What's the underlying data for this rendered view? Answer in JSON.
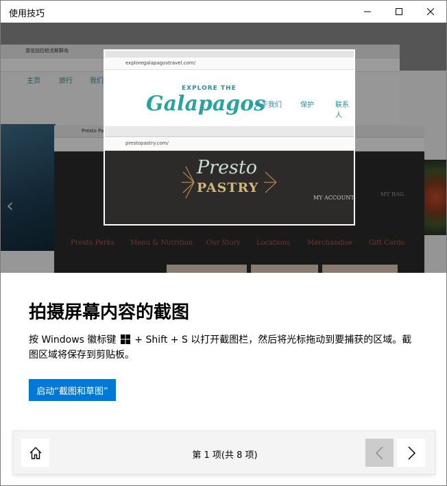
{
  "window": {
    "title": "使用技巧",
    "controls": [
      "minimize-icon",
      "maximize-icon",
      "close-icon"
    ]
  },
  "hero": {
    "bg_site": {
      "tab_title": "游览加拉帕戈斯群岛",
      "nav": [
        "主页",
        "旅行",
        "我们的 方法"
      ]
    },
    "snip_site": {
      "url": "exploregalapagostravel.com/",
      "logo_small": "EXPLORE THE",
      "logo_big": "Galapagos",
      "nav": [
        "关于我们",
        "保护",
        "联系人"
      ]
    },
    "pp_site": {
      "tab_title": "Presto Pastry",
      "url": "prestopastry.com/",
      "logo_line1": "Presto",
      "logo_line2": "PASTRY",
      "account": "MY ACCOUNT",
      "bag": "MY BAG",
      "nav": [
        "Presto Perks",
        "Menu & Nutrition",
        "Our Story",
        "Locations",
        "Merchandise",
        "Gift Cards"
      ]
    }
  },
  "content": {
    "heading": "拍摄屏幕内容的截图",
    "desc_before": "按 Windows 徽标键 ",
    "desc_after": " + Shift + S 以打开截图栏，然后将光标拖动到要捕获的区域。截图区域将保存到剪贴板。",
    "launch_label": "启动“截图和草图”"
  },
  "footer": {
    "pager": "第 1 项(共 8 项)"
  },
  "colors": {
    "accent": "#0078d7",
    "disabled": "#cccccc"
  }
}
